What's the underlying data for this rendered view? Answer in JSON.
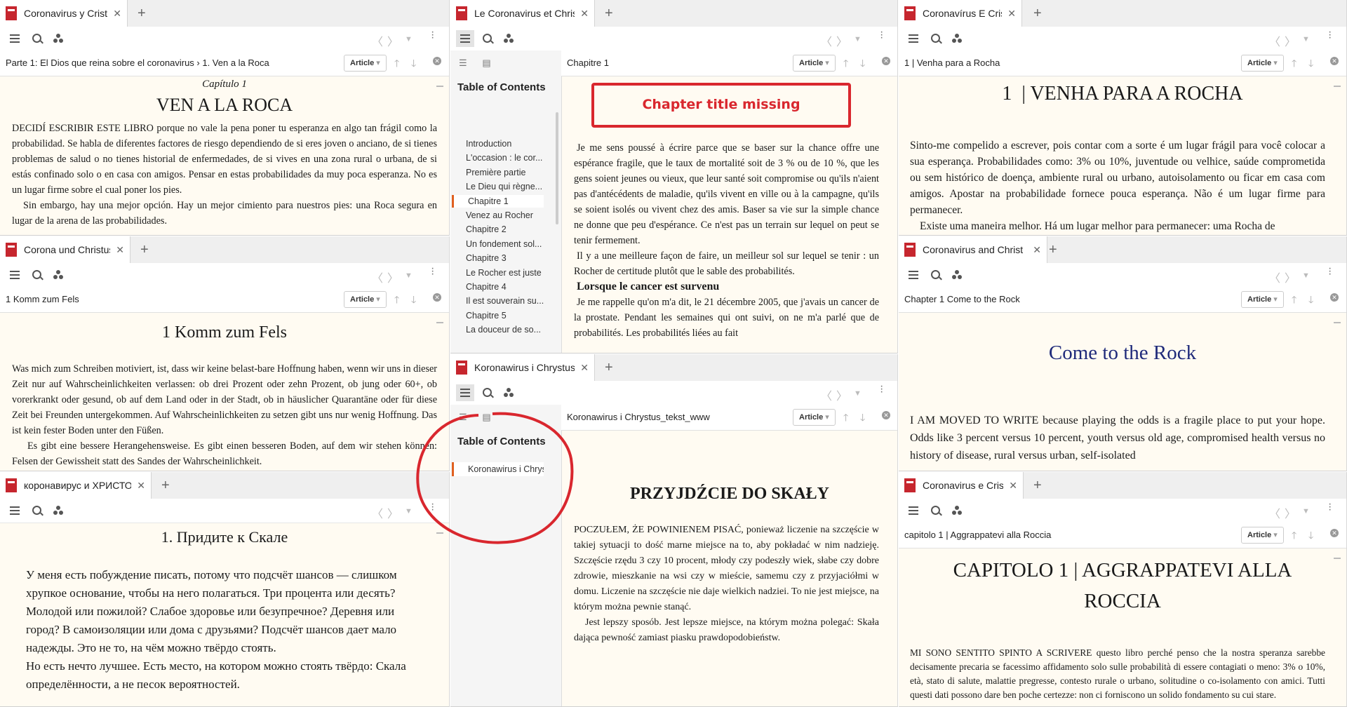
{
  "panes": {
    "es": {
      "tab_title": "Coronavirus y Cristo",
      "breadcrumb": "Parte 1: El Dios que reina sobre el coronavirus  ›  1. Ven a la Roca",
      "view_mode": "Article",
      "chapter_label": "Capítulo 1",
      "heading": "VEN A LA ROCA",
      "para1": "DECIDÍ ESCRIBIR ESTE LIBRO porque no vale la pena poner tu esperanza en algo tan frágil como la probabilidad. Se habla de diferentes factores de riesgo dependiendo de si eres joven o anciano, de si tienes problemas de salud o no tienes historial de enfermedades, de si vives en una zona rural o urbana, de si estás confinado solo o en casa con amigos. Pensar en estas probabilidades da muy poca esperanza. No es un lugar firme sobre el cual poner los pies.",
      "para2": "Sin embargo, hay una mejor opción. Hay un mejor cimiento para nuestros pies: una Roca segura en lugar de la arena de las probabilidades."
    },
    "fr": {
      "tab_title": "Le Coronavirus et Christ",
      "breadcrumb": "Chapitre 1",
      "view_mode": "Article",
      "toc_title": "Table of Contents",
      "toc_items": [
        "Introduction",
        "L'occasion : le cor...",
        "Première partie",
        "Le Dieu qui règne...",
        "Chapitre 1",
        "Venez au Rocher",
        "Chapitre 2",
        "Un fondement sol...",
        "Chapitre 3",
        "Le Rocher est juste",
        "Chapitre 4",
        "Il est souverain su...",
        "Chapitre 5",
        "La douceur de so..."
      ],
      "toc_selected": "Chapitre 1",
      "annotation": "Chapter title missing",
      "para1": "Je me sens poussé à écrire parce que se baser sur la chance offre une espérance fragile, que le taux de mortalité soit de 3 % ou de 10 %, que les gens soient jeunes ou vieux, que leur santé soit compromise ou qu'ils n'aient pas d'antécédents de maladie, qu'ils vivent en ville ou à la campagne, qu'ils se soient isolés ou vivent chez des amis. Baser sa vie sur la simple chance ne donne que peu d'espérance. Ce n'est pas un terrain sur lequel on peut se tenir fermement.",
      "para2": "Il y a une meilleure façon de faire, un meilleur sol sur lequel se tenir : un Rocher de certitude plutôt que le sable des probabilités.",
      "subheading": "Lorsque le cancer est survenu",
      "para3": "Je me rappelle qu'on m'a dit, le 21 décembre 2005, que j'avais un cancer de la prostate. Pendant les semaines qui ont suivi, on ne m'a parlé que de probabilités. Les probabilités liées au fait"
    },
    "pt": {
      "tab_title": "Coronavírus E Cristo",
      "breadcrumb": "1 | Venha para a Rocha",
      "view_mode": "Article",
      "heading": "1  | VENHA PARA A ROCHA",
      "para1": "Sinto-me compelido a escrever, pois contar com a sorte é um lugar frágil para você colocar a sua esperança. Probabilidades como: 3% ou 10%, juventude ou velhice, saúde comprometida ou sem histórico de doença, ambiente rural ou urbano, autoisolamento ou ficar em casa com amigos. Apostar na probabilidade fornece pouca esperança. Não é um lugar firme para permanecer.",
      "para2": "Existe uma maneira melhor. Há um lugar melhor para permanecer: uma Rocha de"
    },
    "de": {
      "tab_title": "Corona und Christus",
      "breadcrumb": "1 Komm zum Fels",
      "view_mode": "Article",
      "heading": "1 Komm zum Fels",
      "para1": "Was mich zum Schreiben motiviert, ist, dass wir keine belast-bare Hoffnung haben, wenn wir uns in dieser Zeit nur auf Wahrscheinlichkeiten verlassen: ob drei Prozent oder zehn Prozent, ob jung oder 60+, ob vorerkrankt oder gesund, ob auf dem Land oder in der Stadt, ob in häuslicher Quarantäne oder für diese Zeit bei Freunden untergekommen. Auf Wahrscheinlichkeiten zu setzen gibt uns nur wenig Hoffnung. Das ist kein fester Boden unter den Füßen.",
      "para2": "Es gibt eine bessere Herangehensweise. Es gibt einen besseren Boden, auf dem wir stehen können: Felsen der Gewissheit statt des Sandes der Wahrscheinlichkeit."
    },
    "en": {
      "tab_title": "Coronavirus and Christ",
      "breadcrumb": "Chapter 1 Come to the Rock",
      "view_mode": "Article",
      "heading": "Come to the Rock",
      "para1": "I AM MOVED TO WRITE because playing the odds is a fragile place to put your hope. Odds like 3 percent versus 10 percent, youth versus old age, compromised health versus no history of disease, rural versus urban, self-isolated"
    },
    "pl": {
      "tab_title": "Koronawirus i Chrystus",
      "breadcrumb": "Koronawirus i Chrystus_tekst_www",
      "view_mode": "Article",
      "toc_title": "Table of Contents",
      "toc_items": [
        "Koronawirus i Chrys..."
      ],
      "heading": "PRZYJDŹCIE DO SKAŁY",
      "para1": "POCZUŁEM, ŻE POWINIENEM PISAĆ, ponieważ liczenie na szczęście w takiej sytuacji to dość marne miejsce na to, aby pokładać w nim nadzieję. Szczęście rzędu 3 czy 10 procent, młody czy podeszły wiek, słabe czy dobre zdrowie, mieszkanie na wsi czy w mieście, samemu czy z przyjaciółmi w domu. Liczenie na szczęście nie daje wielkich nadziei. To nie jest miejsce, na którym można pewnie stanąć.",
      "para2": "Jest lepszy sposób. Jest lepsze miejsce, na którym można polegać: Skała dająca pewność zamiast piasku prawdopodobieństw."
    },
    "ru": {
      "tab_title": "коронавирус и ХРИСТОС",
      "heading": "1. Придите к Скале",
      "para1": "У меня есть побуждение писать, потому что подсчёт шансов — слишком хрупкое основание, чтобы на него полагаться. Три процента или десять? Молодой или пожилой? Слабое здоровье или безупречное? Деревня или город? В самоизоляции или дома с друзьями? Подсчёт шансов дает мало надежды. Это не то, на чём можно твёрдо стоять.",
      "para2": "Но есть нечто лучшее. Есть место, на котором можно стоять твёрдо: Скала определённости, а не песок вероятностей."
    },
    "it": {
      "tab_title": "Coronavirus e Cristo",
      "breadcrumb": "capitolo 1 | Aggrappatevi alla Roccia",
      "view_mode": "Article",
      "heading": "CAPITOLO 1 | AGGRAPPATEVI ALLA ROCCIA",
      "para1": "MI SONO SENTITO SPINTO A SCRIVERE questo libro perché penso che la nostra speranza sarebbe decisamente precaria se facessimo affidamento solo sulle probabilità di essere contagiati o meno: 3% o 10%, età, stato di salute, malattie pregresse, contesto rurale o urbano, solitudine o co-isolamento con amici. Tutti questi dati possono dare ben poche certezze: non ci forniscono un solido fondamento su cui stare."
    }
  },
  "colors": {
    "annotation": "#d9272e",
    "toc_accent": "#e06020",
    "page_bg": "#fffbf2",
    "en_heading": "#1f2a7a"
  },
  "icons": [
    "book-icon",
    "menu-icon",
    "search-icon",
    "annotations-icon",
    "back-icon",
    "forward-icon",
    "chevron-down-icon",
    "more-vert-icon",
    "close-icon",
    "add-tab-icon",
    "arrow-up-icon",
    "arrow-down-icon"
  ]
}
